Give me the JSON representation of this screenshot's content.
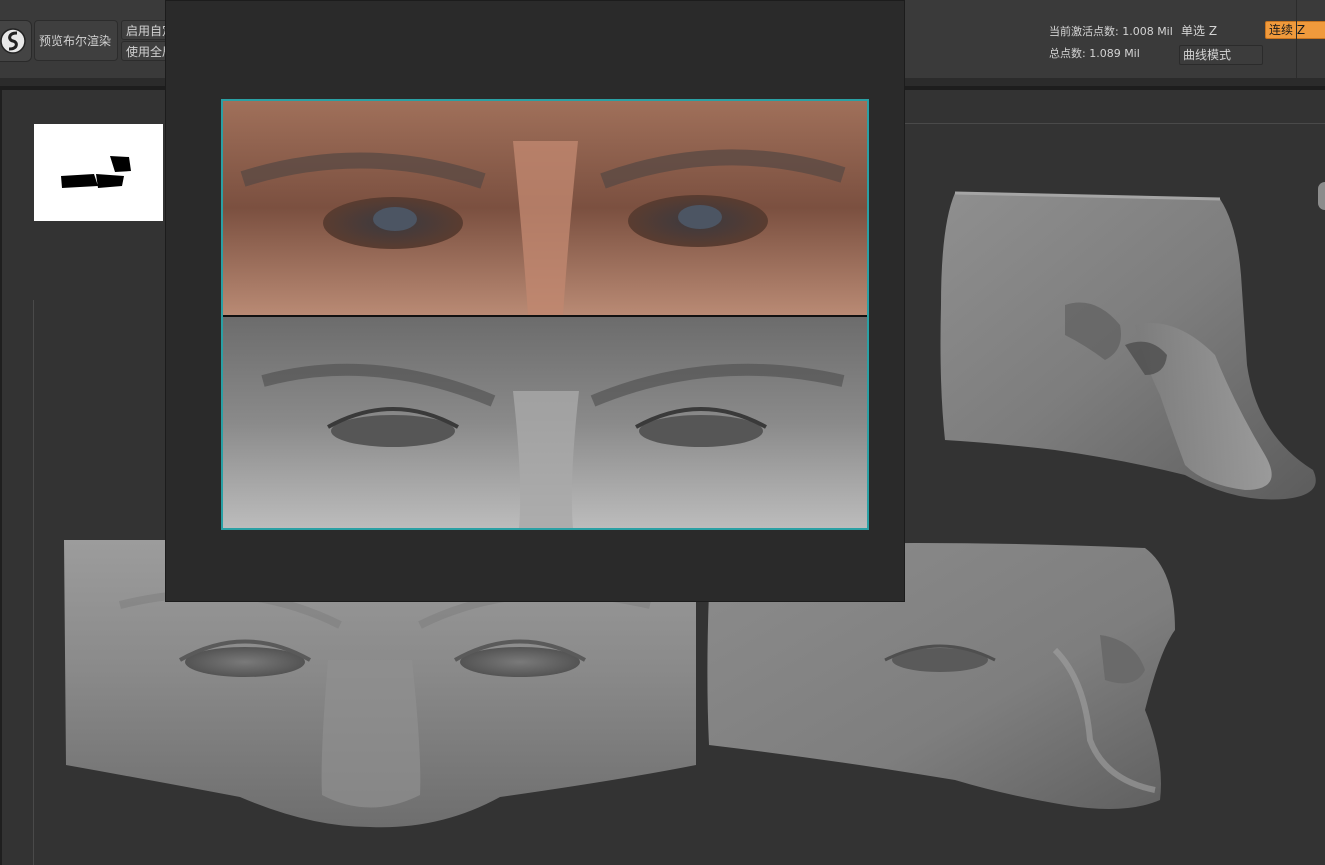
{
  "toolbar": {
    "logo_icon": "zbrush-logo-icon",
    "preview_bool_label": "预览布尔渲染",
    "enable_custom_label": "启用自定",
    "use_global_label": "使用全局",
    "active_points_label": "当前激活点数: 1.008 Mil",
    "total_points_label": "总点数: 1.089 Mil",
    "single_select_label": "单选 Z",
    "continuous_label": "连续 Z",
    "curve_mode_label": "曲线模式",
    "accent_color": "#f09a3c"
  },
  "reference_panel": {
    "border_color": "#2aa0a4",
    "top_half": "photo-eyes-reference",
    "bottom_half": "sculpt-eyes-reference"
  },
  "canvas": {
    "models": [
      "eyes-sculpt-front-view",
      "eyes-sculpt-three-quarter-view",
      "eyes-sculpt-side-view"
    ]
  }
}
